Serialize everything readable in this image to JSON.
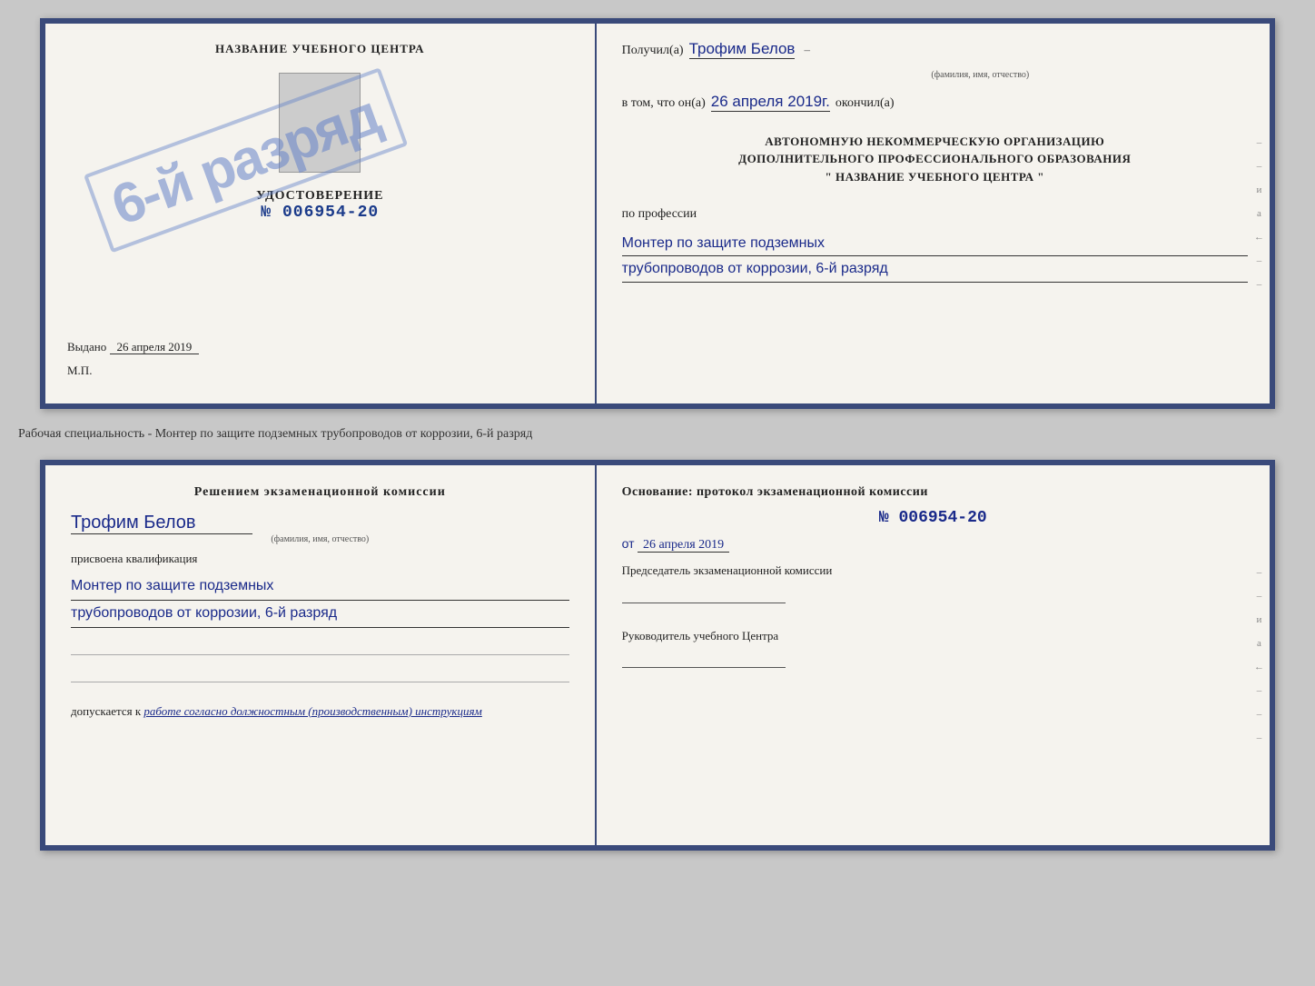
{
  "page": {
    "background": "#c8c8c8"
  },
  "top_cert": {
    "left": {
      "title": "НАЗВАНИЕ УЧЕБНОГО ЦЕНТРА",
      "udost_label": "УДОСТОВЕРЕНИЕ",
      "udost_num": "№ 006954-20",
      "stamp_text": "6-й разряд",
      "vydano_label": "Выдано",
      "vydano_date": "26 апреля 2019",
      "mp_label": "М.П."
    },
    "right": {
      "poluchil_label": "Получил(a)",
      "poluchil_name": "Трофим Белов",
      "fio_label": "(фамилия, имя, отчество)",
      "v_tom_label": "в том, что он(a)",
      "date_val": "26 апреля 2019г.",
      "okonchil_label": "окончил(а)",
      "org_line1": "АВТОНОМНУЮ НЕКОММЕРЧЕСКУЮ ОРГАНИЗАЦИЮ",
      "org_line2": "ДОПОЛНИТЕЛЬНОГО ПРОФЕССИОНАЛЬНОГО ОБРАЗОВАНИЯ",
      "org_name": "\" НАЗВАНИЕ УЧЕБНОГО ЦЕНТРА \"",
      "po_professii": "по профессии",
      "prof_line1": "Монтер по защите подземных",
      "prof_line2": "трубопроводов от коррозии, 6-й разряд"
    }
  },
  "specialty_text": "Рабочая специальность - Монтер по защите подземных трубопроводов от коррозии, 6-й разряд",
  "bottom_cert": {
    "left": {
      "resheniem_label": "Решением экзаменационной комиссии",
      "name_hw": "Трофим Белов",
      "fio_label": "(фамилия, имя, отчество)",
      "prisvoena_label": "присвоена квалификация",
      "prof_line1": "Монтер по защите подземных",
      "prof_line2": "трубопроводов от коррозии, 6-й разряд",
      "dopusk_label": "допускается к",
      "dopusk_hw": "работе согласно должностным (производственным) инструкциям"
    },
    "right": {
      "osnov_label": "Основание: протокол экзаменационной комиссии",
      "num_val": "№ 006954-20",
      "ot_label": "от",
      "ot_date": "26 апреля 2019",
      "predsedatel_label": "Председатель экзаменационной комиссии",
      "rukov_label": "Руководитель учебного Центра"
    }
  },
  "margin_chars": {
    "right1": "–",
    "right2": "–",
    "right3": "и",
    "right4": "а",
    "right5": "←",
    "right6": "–",
    "right7": "–",
    "right8": "–"
  }
}
